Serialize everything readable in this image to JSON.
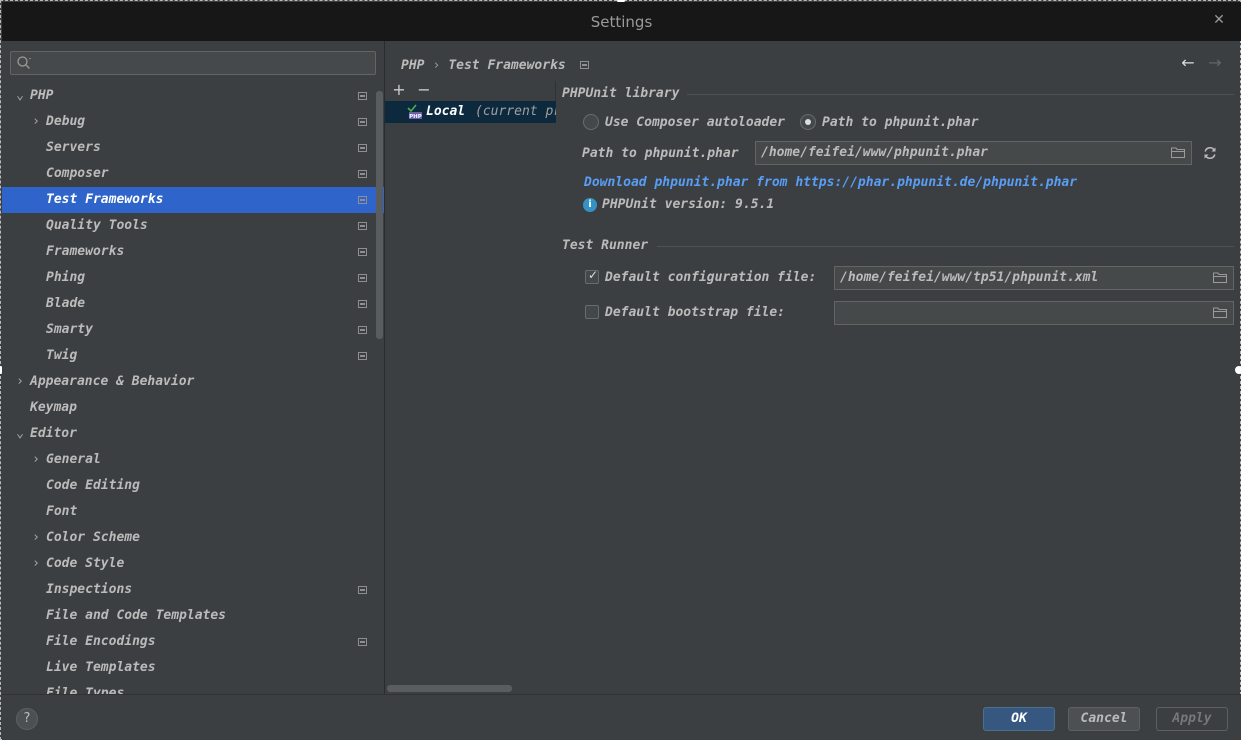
{
  "window": {
    "title": "Settings",
    "close_glyph": "✕"
  },
  "search": {
    "placeholder": "",
    "value": "",
    "icon": "search-icon"
  },
  "sidebar": {
    "items": [
      {
        "label": "PHP",
        "chevron": "⌄",
        "expanded": true
      },
      {
        "label": "Debug",
        "chevron": "›"
      },
      {
        "label": "Servers"
      },
      {
        "label": "Composer"
      },
      {
        "label": "Test Frameworks",
        "selected": true
      },
      {
        "label": "Quality Tools"
      },
      {
        "label": "Frameworks"
      },
      {
        "label": "Phing"
      },
      {
        "label": "Blade"
      },
      {
        "label": "Smarty"
      },
      {
        "label": "Twig"
      },
      {
        "label": "Appearance & Behavior",
        "chevron": "›"
      },
      {
        "label": "Keymap"
      },
      {
        "label": "Editor",
        "chevron": "⌄",
        "expanded": true
      },
      {
        "label": "General",
        "chevron": "›"
      },
      {
        "label": "Code Editing"
      },
      {
        "label": "Font"
      },
      {
        "label": "Color Scheme",
        "chevron": "›"
      },
      {
        "label": "Code Style",
        "chevron": "›"
      },
      {
        "label": "Inspections"
      },
      {
        "label": "File and Code Templates"
      },
      {
        "label": "File Encodings"
      },
      {
        "label": "Live Templates"
      },
      {
        "label": "File Types"
      }
    ]
  },
  "header": {
    "breadcrumb": [
      "PHP",
      "Test Frameworks"
    ],
    "separator": "›",
    "back_glyph": "←",
    "forward_glyph": "→"
  },
  "list": {
    "add_glyph": "+",
    "remove_glyph": "−",
    "items": [
      {
        "label": "Local",
        "suffix": "(current project interpreter)"
      }
    ]
  },
  "phpunit": {
    "section_title": "PHPUnit library",
    "option_composer": "Use Composer autoloader",
    "option_path": "Path to phpunit.phar",
    "selected_option": "Path to phpunit.phar",
    "path_label": "Path to phpunit.phar",
    "path_value": "/home/feifei/www/phpunit.phar",
    "download_link": "Download phpunit.phar from https://phar.phpunit.de/phpunit.phar",
    "version_text": "PHPUnit version: 9.5.1",
    "info_glyph": "i"
  },
  "test_runner": {
    "section_title": "Test Runner",
    "default_config_label": "Default configuration file:",
    "default_config_checked": true,
    "default_config_value": "/home/feifei/www/tp51/phpunit.xml",
    "default_bootstrap_label": "Default bootstrap file:",
    "default_bootstrap_checked": false,
    "default_bootstrap_value": "",
    "check_glyph": "✓"
  },
  "footer": {
    "help_glyph": "?",
    "ok_label": "OK",
    "cancel_label": "Cancel",
    "apply_label": "Apply"
  },
  "colors": {
    "background": "#3c3f41",
    "titlebar": "#171717",
    "selection": "#2f65ca",
    "link": "#589df6",
    "ok_button": "#365880",
    "info": "#3592c4"
  }
}
